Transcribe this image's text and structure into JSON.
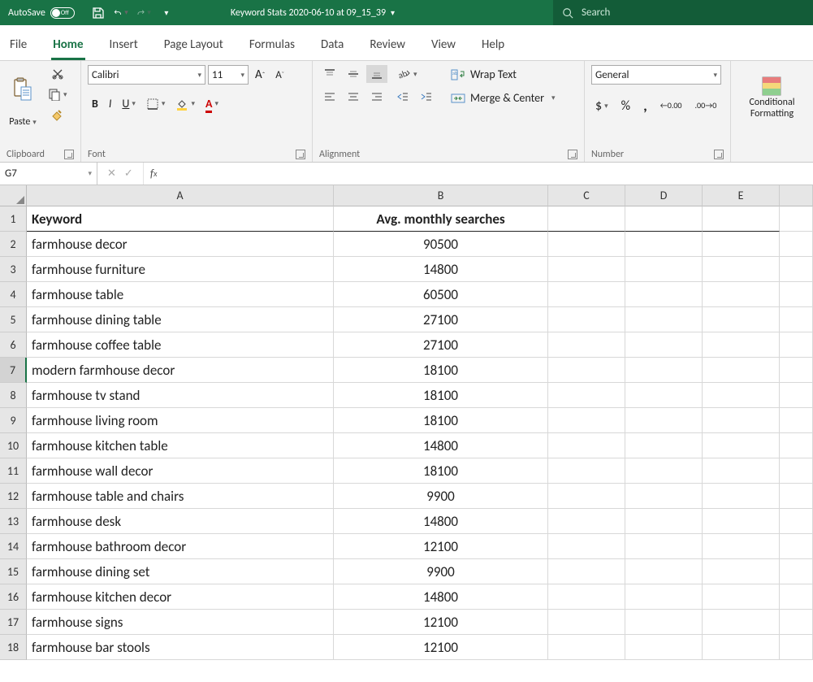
{
  "titlebar": {
    "autosave_label": "AutoSave",
    "autosave_state": "Off",
    "filename": "Keyword Stats 2020-06-10 at 09_15_39",
    "search_placeholder": "Search"
  },
  "tabs": [
    "File",
    "Home",
    "Insert",
    "Page Layout",
    "Formulas",
    "Data",
    "Review",
    "View",
    "Help"
  ],
  "active_tab": "Home",
  "ribbon": {
    "clipboard_label": "Clipboard",
    "paste_label": "Paste",
    "font_label": "Font",
    "font_name": "Calibri",
    "font_size": "11",
    "alignment_label": "Alignment",
    "wrap_label": "Wrap Text",
    "merge_label": "Merge & Center",
    "number_label": "Number",
    "number_format": "General",
    "styles_cond": "Conditional",
    "styles_fmt": "Formatting"
  },
  "namebox": "G7",
  "formula": "",
  "columns": [
    "A",
    "B",
    "C",
    "D",
    "E"
  ],
  "col_widths": {
    "A": 378,
    "B": 264,
    "C": 95,
    "D": 95,
    "E": 95
  },
  "headers": {
    "A": "Keyword",
    "B": "Avg. monthly searches"
  },
  "rows": [
    {
      "n": 1,
      "A": "Keyword",
      "B": "Avg. monthly searches",
      "header": true
    },
    {
      "n": 2,
      "A": "farmhouse decor",
      "B": "90500"
    },
    {
      "n": 3,
      "A": "farmhouse furniture",
      "B": "14800"
    },
    {
      "n": 4,
      "A": "farmhouse table",
      "B": "60500"
    },
    {
      "n": 5,
      "A": "farmhouse dining table",
      "B": "27100"
    },
    {
      "n": 6,
      "A": "farmhouse coffee table",
      "B": "27100"
    },
    {
      "n": 7,
      "A": "modern farmhouse decor",
      "B": "18100",
      "selected": true
    },
    {
      "n": 8,
      "A": "farmhouse tv stand",
      "B": "18100"
    },
    {
      "n": 9,
      "A": "farmhouse living room",
      "B": "18100"
    },
    {
      "n": 10,
      "A": "farmhouse kitchen table",
      "B": "14800"
    },
    {
      "n": 11,
      "A": "farmhouse wall decor",
      "B": "18100"
    },
    {
      "n": 12,
      "A": "farmhouse table and chairs",
      "B": "9900"
    },
    {
      "n": 13,
      "A": "farmhouse desk",
      "B": "14800"
    },
    {
      "n": 14,
      "A": "farmhouse bathroom decor",
      "B": "12100"
    },
    {
      "n": 15,
      "A": "farmhouse dining set",
      "B": "9900"
    },
    {
      "n": 16,
      "A": "farmhouse kitchen decor",
      "B": "14800"
    },
    {
      "n": 17,
      "A": "farmhouse signs",
      "B": "12100"
    },
    {
      "n": 18,
      "A": "farmhouse bar stools",
      "B": "12100"
    }
  ]
}
